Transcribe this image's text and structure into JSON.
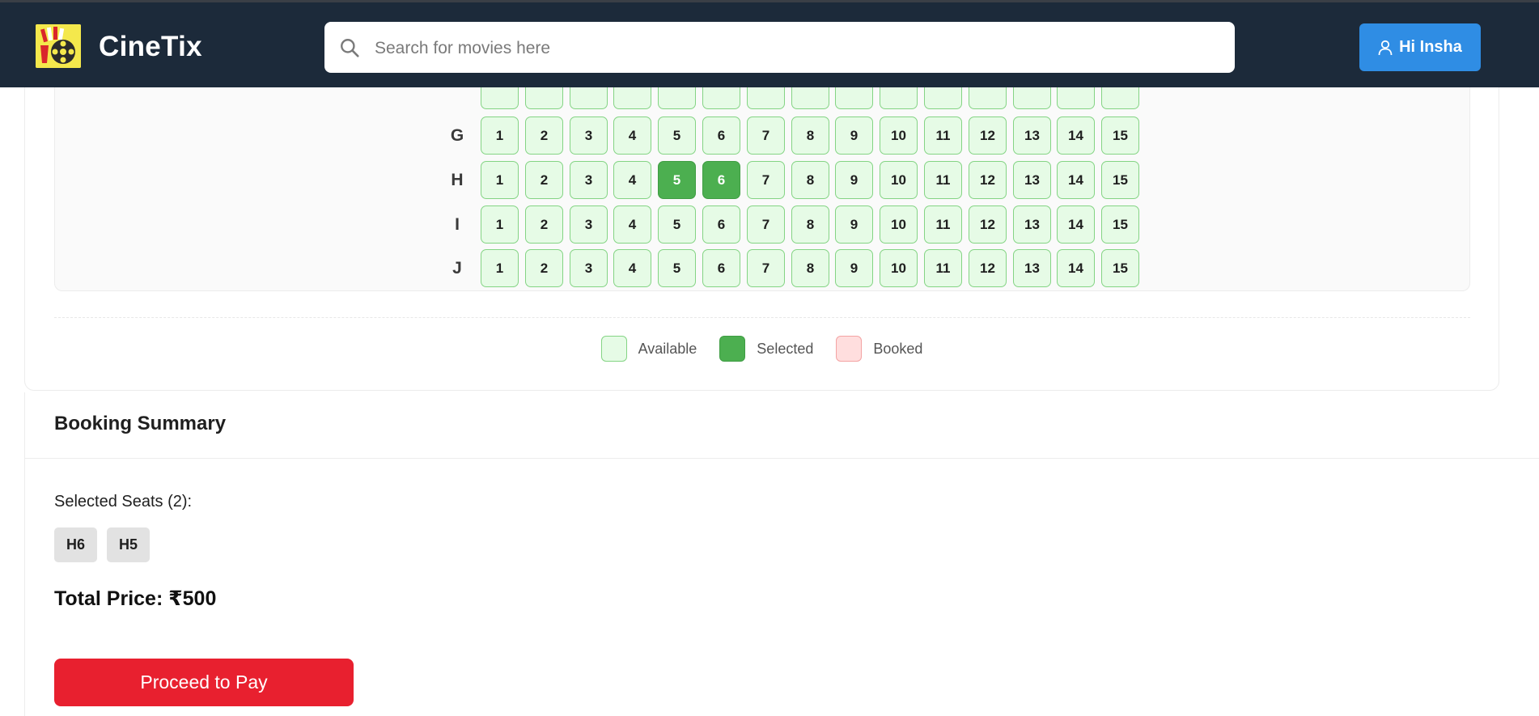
{
  "header": {
    "brand": "CineTix",
    "logo_icon": "film-reel-popcorn-logo",
    "search_placeholder": "Search for movies here",
    "search_value": "",
    "user_button": "Hi Insha",
    "colors": {
      "header_bg": "#1c2a3a",
      "user_button_bg": "#2f8de4"
    }
  },
  "seat_map": {
    "partial_top_row": {
      "label": "",
      "seats": [
        "",
        "",
        "",
        "",
        "",
        "",
        "",
        "",
        "",
        "",
        "",
        "",
        "",
        "",
        ""
      ]
    },
    "rows": [
      {
        "label": "G",
        "seats": [
          {
            "n": "1",
            "status": "available"
          },
          {
            "n": "2",
            "status": "available"
          },
          {
            "n": "3",
            "status": "available"
          },
          {
            "n": "4",
            "status": "available"
          },
          {
            "n": "5",
            "status": "available"
          },
          {
            "n": "6",
            "status": "available"
          },
          {
            "n": "7",
            "status": "available"
          },
          {
            "n": "8",
            "status": "available"
          },
          {
            "n": "9",
            "status": "available"
          },
          {
            "n": "10",
            "status": "available"
          },
          {
            "n": "11",
            "status": "available"
          },
          {
            "n": "12",
            "status": "available"
          },
          {
            "n": "13",
            "status": "available"
          },
          {
            "n": "14",
            "status": "available"
          },
          {
            "n": "15",
            "status": "available"
          }
        ]
      },
      {
        "label": "H",
        "seats": [
          {
            "n": "1",
            "status": "available"
          },
          {
            "n": "2",
            "status": "available"
          },
          {
            "n": "3",
            "status": "available"
          },
          {
            "n": "4",
            "status": "available"
          },
          {
            "n": "5",
            "status": "selected"
          },
          {
            "n": "6",
            "status": "selected"
          },
          {
            "n": "7",
            "status": "available"
          },
          {
            "n": "8",
            "status": "available"
          },
          {
            "n": "9",
            "status": "available"
          },
          {
            "n": "10",
            "status": "available"
          },
          {
            "n": "11",
            "status": "available"
          },
          {
            "n": "12",
            "status": "available"
          },
          {
            "n": "13",
            "status": "available"
          },
          {
            "n": "14",
            "status": "available"
          },
          {
            "n": "15",
            "status": "available"
          }
        ]
      },
      {
        "label": "I",
        "seats": [
          {
            "n": "1",
            "status": "available"
          },
          {
            "n": "2",
            "status": "available"
          },
          {
            "n": "3",
            "status": "available"
          },
          {
            "n": "4",
            "status": "available"
          },
          {
            "n": "5",
            "status": "available"
          },
          {
            "n": "6",
            "status": "available"
          },
          {
            "n": "7",
            "status": "available"
          },
          {
            "n": "8",
            "status": "available"
          },
          {
            "n": "9",
            "status": "available"
          },
          {
            "n": "10",
            "status": "available"
          },
          {
            "n": "11",
            "status": "available"
          },
          {
            "n": "12",
            "status": "available"
          },
          {
            "n": "13",
            "status": "available"
          },
          {
            "n": "14",
            "status": "available"
          },
          {
            "n": "15",
            "status": "available"
          }
        ]
      },
      {
        "label": "J",
        "seats": [
          {
            "n": "1",
            "status": "available"
          },
          {
            "n": "2",
            "status": "available"
          },
          {
            "n": "3",
            "status": "available"
          },
          {
            "n": "4",
            "status": "available"
          },
          {
            "n": "5",
            "status": "available"
          },
          {
            "n": "6",
            "status": "available"
          },
          {
            "n": "7",
            "status": "available"
          },
          {
            "n": "8",
            "status": "available"
          },
          {
            "n": "9",
            "status": "available"
          },
          {
            "n": "10",
            "status": "available"
          },
          {
            "n": "11",
            "status": "available"
          },
          {
            "n": "12",
            "status": "available"
          },
          {
            "n": "13",
            "status": "available"
          },
          {
            "n": "14",
            "status": "available"
          },
          {
            "n": "15",
            "status": "available"
          }
        ]
      }
    ],
    "colors": {
      "available": "#e6fbe6",
      "selected": "#4caf50",
      "booked": "#ffdede"
    }
  },
  "legend": {
    "available": "Available",
    "selected": "Selected",
    "booked": "Booked"
  },
  "summary": {
    "title": "Booking Summary",
    "selected_label": "Selected Seats (2):",
    "chips": [
      "H6",
      "H5"
    ],
    "total": "Total Price: ₹500",
    "pay_button": "Proceed to Pay",
    "colors": {
      "pay_button_bg": "#e8202f"
    }
  }
}
